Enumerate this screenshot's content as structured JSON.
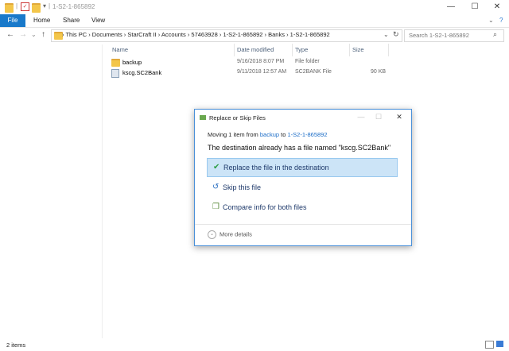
{
  "window": {
    "title": "1-S2-1-865892",
    "minimize": "—",
    "maximize": "☐",
    "close": "✕"
  },
  "ribbon": {
    "tabs": [
      "File",
      "Home",
      "Share",
      "View"
    ],
    "expand": "⌄",
    "help": "?"
  },
  "address": {
    "back": "←",
    "forward": "→",
    "recent": "⌄",
    "up": "↑",
    "crumbs": "›  This PC  ›  Documents  ›  StarCraft II  ›  Accounts  ›  57463928  ›  1-S2-1-865892  ›  Banks  ›  1-S2-1-865892",
    "dropdown": "⌄",
    "refresh": "↻",
    "search_placeholder": "Search 1-S2-1-865892",
    "search_icon": "⌕"
  },
  "columns": [
    "Name",
    "Date modified",
    "Type",
    "Size"
  ],
  "files": [
    {
      "name": "backup",
      "date": "9/16/2018 8:07 PM",
      "type": "File folder",
      "size": "",
      "icon": "folder-icon"
    },
    {
      "name": "kscg.SC2Bank",
      "date": "9/11/2018 12:57 AM",
      "type": "SC2BANK File",
      "size": "90 KB",
      "icon": "file-icon"
    }
  ],
  "status": "2 items",
  "dialog": {
    "title": "Replace or Skip Files",
    "minimize": "—",
    "maximize": "☐",
    "close": "✕",
    "moving_prefix": "Moving 1 item from ",
    "from": "backup",
    "to_word": " to ",
    "to": "1-S2-1-865892",
    "message": "The destination already has a file named \"kscg.SC2Bank\"",
    "options": [
      {
        "label": "Replace the file in the destination",
        "icon": "checkmark-icon"
      },
      {
        "label": "Skip this file",
        "icon": "skip-icon"
      },
      {
        "label": "Compare info for both files",
        "icon": "compare-icon"
      }
    ],
    "more_details": "More details",
    "more_details_icon": "⌄"
  },
  "colors": {
    "accent": "#1979ca",
    "link": "#1a6cc7",
    "highlight": "#cce4f7"
  }
}
